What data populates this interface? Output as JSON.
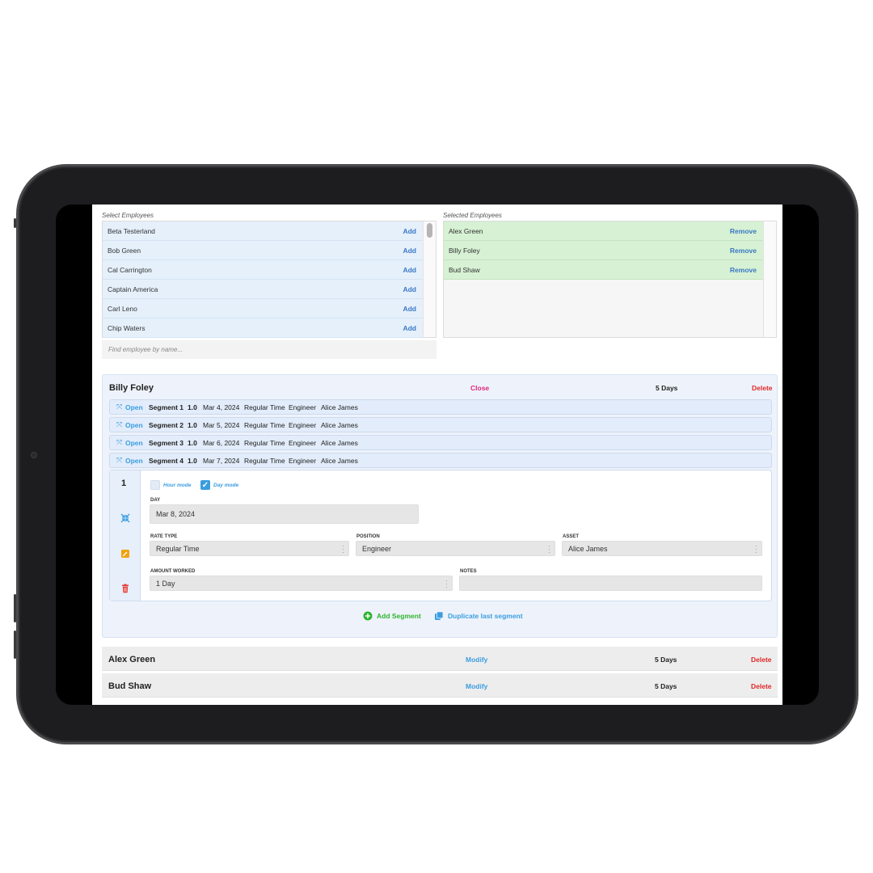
{
  "select_panel": {
    "label": "Select Employees",
    "action_label": "Add",
    "employees": [
      "Beta Testerland",
      "Bob Green",
      "Cal Carrington",
      "Captain America",
      "Carl Leno",
      "Chip Waters"
    ],
    "search_placeholder": "Find employee by name..."
  },
  "selected_panel": {
    "label": "Selected Employees",
    "action_label": "Remove",
    "employees": [
      "Alex Green",
      "Billy Foley",
      "Bud Shaw"
    ]
  },
  "active_employee": {
    "name": "Billy Foley",
    "close_label": "Close",
    "days": "5 Days",
    "delete_label": "Delete",
    "segments": [
      {
        "open": "Open",
        "name": "Segment 1",
        "value": "1.0",
        "date": "Mar 4, 2024",
        "rate": "Regular Time",
        "position": "Engineer",
        "asset": "Alice James"
      },
      {
        "open": "Open",
        "name": "Segment 2",
        "value": "1.0",
        "date": "Mar 5, 2024",
        "rate": "Regular Time",
        "position": "Engineer",
        "asset": "Alice James"
      },
      {
        "open": "Open",
        "name": "Segment 3",
        "value": "1.0",
        "date": "Mar 6, 2024",
        "rate": "Regular Time",
        "position": "Engineer",
        "asset": "Alice James"
      },
      {
        "open": "Open",
        "name": "Segment 4",
        "value": "1.0",
        "date": "Mar 7, 2024",
        "rate": "Regular Time",
        "position": "Engineer",
        "asset": "Alice James"
      }
    ],
    "editor": {
      "number": "1",
      "hour_mode_label": "Hour mode",
      "hour_mode_checked": false,
      "day_mode_label": "Day mode",
      "day_mode_checked": true,
      "day_label": "DAY",
      "day_value": "Mar 8, 2024",
      "rate_type_label": "RATE TYPE",
      "rate_type_value": "Regular Time",
      "position_label": "POSITION",
      "position_value": "Engineer",
      "asset_label": "ASSET",
      "asset_value": "Alice James",
      "amount_label": "AMOUNT WORKED",
      "amount_value": "1 Day",
      "notes_label": "NOTES",
      "notes_value": ""
    },
    "add_segment_label": "Add Segment",
    "duplicate_label": "Duplicate last segment"
  },
  "other_employees": [
    {
      "name": "Alex Green",
      "modify_label": "Modify",
      "days": "5 Days",
      "delete_label": "Delete"
    },
    {
      "name": "Bud Shaw",
      "modify_label": "Modify",
      "days": "5 Days",
      "delete_label": "Delete"
    }
  ],
  "colors": {
    "accent": "#3b9de0",
    "delete": "#e02828",
    "close": "#e0267a",
    "add_green": "#2fb52f"
  },
  "icons": [
    "collapse-icon",
    "edit-icon",
    "trash-icon",
    "plus-circle-icon",
    "duplicate-icon",
    "checkmark-icon"
  ]
}
